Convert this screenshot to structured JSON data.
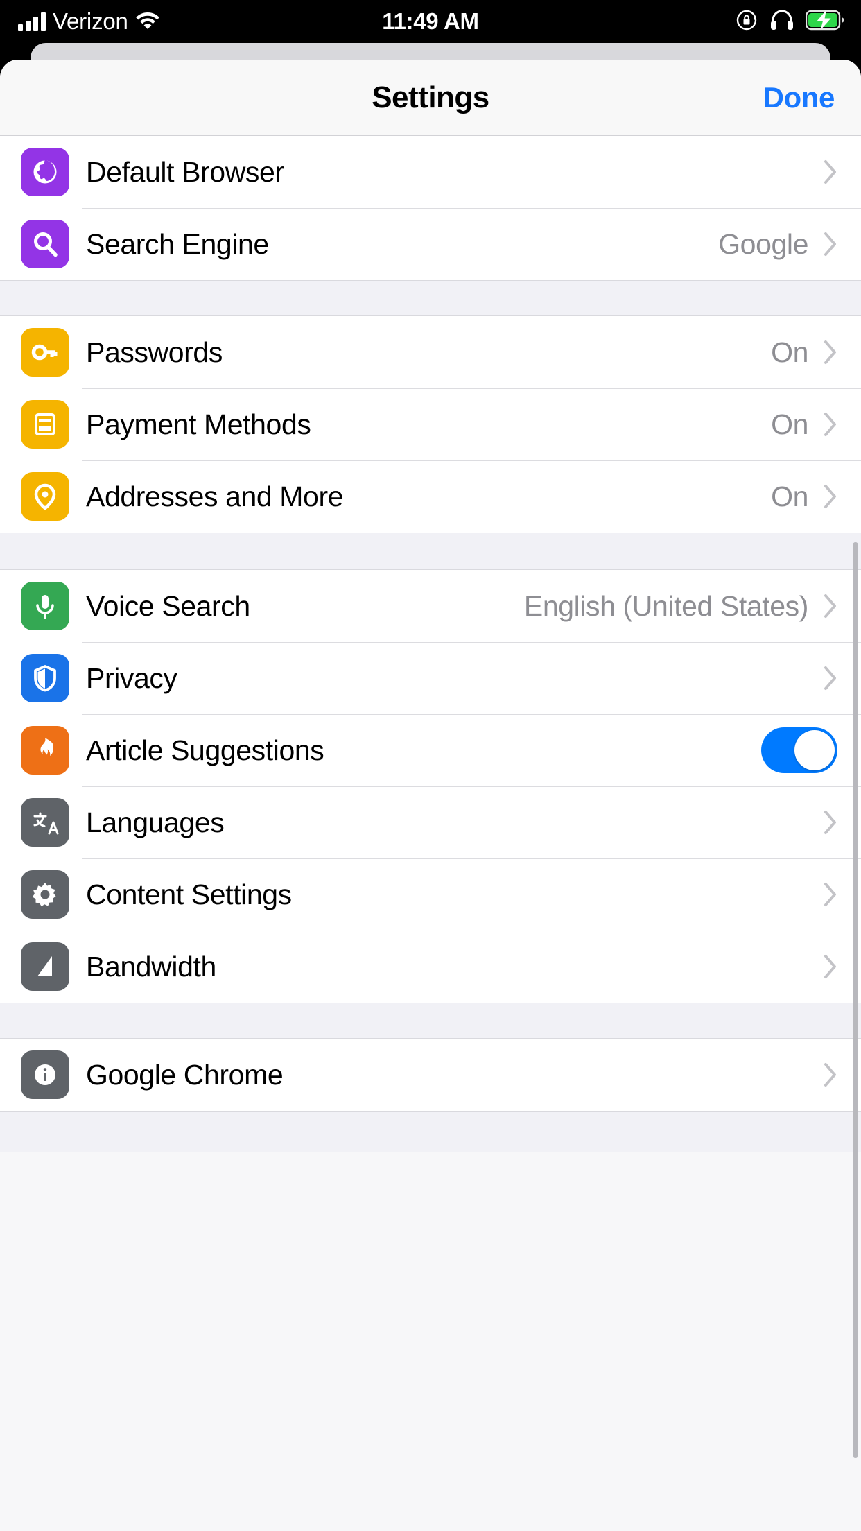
{
  "statusbar": {
    "carrier": "Verizon",
    "time": "11:49 AM",
    "signal_icon": "signal-bars-icon",
    "wifi_icon": "wifi-icon",
    "rotation_lock_icon": "rotation-lock-icon",
    "headphones_icon": "headphones-icon",
    "battery_icon": "battery-charging-icon"
  },
  "navbar": {
    "title": "Settings",
    "done_label": "Done",
    "done_color": "#1878ff"
  },
  "sections": [
    {
      "id": "browser-section",
      "rows": [
        {
          "name": "default-browser",
          "label": "Default Browser",
          "detail": "",
          "accessory": "chevron",
          "icon": "globe-icon",
          "icon_color": "#9334e6"
        },
        {
          "name": "search-engine",
          "label": "Search Engine",
          "detail": "Google",
          "accessory": "chevron",
          "icon": "magnifier-icon",
          "icon_color": "#9334e6"
        }
      ]
    },
    {
      "id": "autofill-section",
      "rows": [
        {
          "name": "passwords",
          "label": "Passwords",
          "detail": "On",
          "accessory": "chevron",
          "icon": "key-icon",
          "icon_color": "#f5b400"
        },
        {
          "name": "payment-methods",
          "label": "Payment Methods",
          "detail": "On",
          "accessory": "chevron",
          "icon": "credit-card-icon",
          "icon_color": "#f5b400"
        },
        {
          "name": "addresses-and-more",
          "label": "Addresses and More",
          "detail": "On",
          "accessory": "chevron",
          "icon": "location-pin-icon",
          "icon_color": "#f5b400"
        }
      ]
    },
    {
      "id": "advanced-section",
      "rows": [
        {
          "name": "voice-search",
          "label": "Voice Search",
          "detail": "English (United States)",
          "accessory": "chevron",
          "icon": "microphone-icon",
          "icon_color": "#34a853"
        },
        {
          "name": "privacy",
          "label": "Privacy",
          "detail": "",
          "accessory": "chevron",
          "icon": "shield-icon",
          "icon_color": "#1a73e8"
        },
        {
          "name": "article-suggestions",
          "label": "Article Suggestions",
          "detail": "",
          "accessory": "toggle",
          "toggle_on": true,
          "toggle_color": "#007aff",
          "icon": "flame-icon",
          "icon_color": "#ee7016"
        },
        {
          "name": "languages",
          "label": "Languages",
          "detail": "",
          "accessory": "chevron",
          "icon": "translate-icon",
          "icon_color": "#5f6368"
        },
        {
          "name": "content-settings",
          "label": "Content Settings",
          "detail": "",
          "accessory": "chevron",
          "icon": "gear-icon",
          "icon_color": "#5f6368"
        },
        {
          "name": "bandwidth",
          "label": "Bandwidth",
          "detail": "",
          "accessory": "chevron",
          "icon": "bandwidth-icon",
          "icon_color": "#5f6368"
        }
      ]
    },
    {
      "id": "about-section",
      "rows": [
        {
          "name": "google-chrome",
          "label": "Google Chrome",
          "detail": "",
          "accessory": "chevron",
          "icon": "info-icon",
          "icon_color": "#5f6368"
        }
      ]
    }
  ]
}
